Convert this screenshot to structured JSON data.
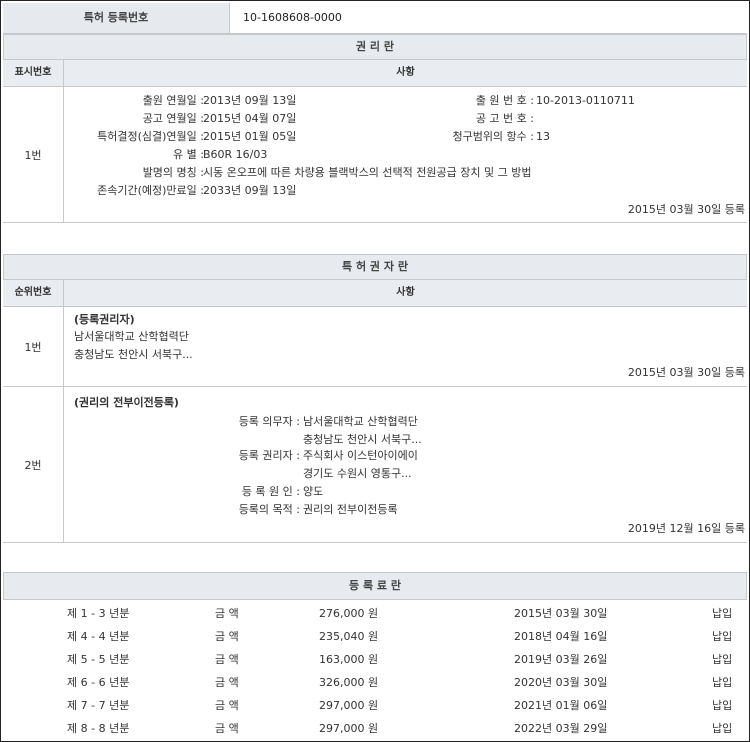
{
  "patent_reg_number": {
    "label": "특허 등록번호",
    "value": "10-1608608-0000"
  },
  "rights": {
    "section_title": "권 리 란",
    "col_index": "표시번호",
    "col_matter": "사항",
    "row_no": "1번",
    "fields": {
      "filing_date_label": "출원 연월일 :",
      "filing_date": "2013년 09월 13일",
      "filing_no_label": "출 원 번 호 :",
      "filing_no": "10-2013-0110711",
      "pub_date_label": "공고 연월일 :",
      "pub_date": "2015년 04월 07일",
      "pub_no_label": "공 고 번 호 :",
      "pub_no": "",
      "decision_date_label": "특허결정(심결)연월일 :",
      "decision_date": "2015년 01월 05일",
      "claims_label": "청구범위의 항수 :",
      "claims": "13",
      "class_label": "유 별 :",
      "class": "B60R 16/03",
      "title_label": "발명의 명칭 :",
      "title": "시동 온오프에 따른 차량용 블랙박스의 선택적 전원공급 장치 및 그 방법",
      "expiry_label": "존속기간(예정)만료일 :",
      "expiry": "2033년 09월 13일"
    },
    "reg_stamp": "2015년 03월 30일 등록"
  },
  "holders": {
    "section_title": "특 허 권 자 란",
    "col_index": "순위번호",
    "col_matter": "사항",
    "row1": {
      "no": "1번",
      "head": "(등록권리자)",
      "name": "남서울대학교 산학협력단",
      "addr": "충청남도 천안시 서북구...",
      "stamp": "2015년 03월 30일 등록"
    },
    "row2": {
      "no": "2번",
      "head": "(권리의 전부이전등록)",
      "obligor_label": "등록 의무자 :",
      "obligor_name": "남서울대학교 산학협력단",
      "obligor_addr": "충청남도 천안시 서북구...",
      "holder_label": "등록 권리자 :",
      "holder_name": "주식회사 이스턴아이에이",
      "holder_addr": "경기도 수원시 영통구...",
      "cause_label": "등 록 원 인 :",
      "cause": "양도",
      "purpose_label": "등록의 목적 :",
      "purpose": "권리의 전부이전등록",
      "stamp": "2019년 12월 16일 등록"
    }
  },
  "fees": {
    "section_title": "등 록 료 란",
    "rows": [
      {
        "year": "제 1 - 3 년분",
        "label": "금 액",
        "amount": "276,000 원",
        "date": "2015년 03월 30일",
        "status": "납입"
      },
      {
        "year": "제 4 - 4 년분",
        "label": "금 액",
        "amount": "235,040 원",
        "date": "2018년 04월 16일",
        "status": "납입"
      },
      {
        "year": "제 5 - 5 년분",
        "label": "금 액",
        "amount": "163,000 원",
        "date": "2019년 03월 26일",
        "status": "납입"
      },
      {
        "year": "제 6 - 6 년분",
        "label": "금 액",
        "amount": "326,000 원",
        "date": "2020년 03월 30일",
        "status": "납입"
      },
      {
        "year": "제 7 - 7 년분",
        "label": "금 액",
        "amount": "297,000 원",
        "date": "2021년 01월 06일",
        "status": "납입"
      },
      {
        "year": "제 8 - 8 년분",
        "label": "금 액",
        "amount": "297,000 원",
        "date": "2022년 03월 29일",
        "status": "납입"
      }
    ]
  }
}
